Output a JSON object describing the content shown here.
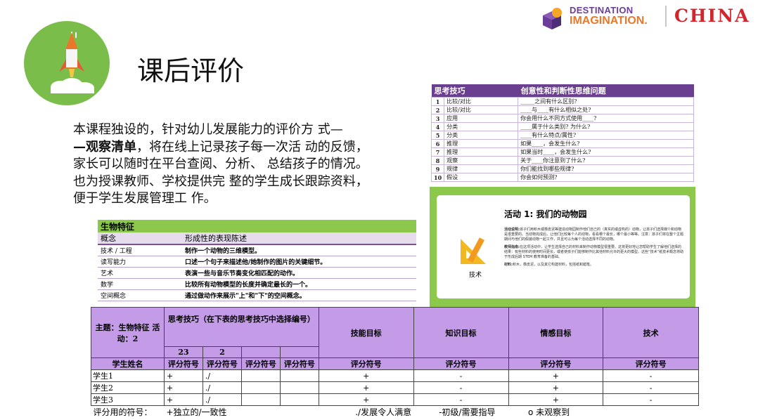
{
  "page": {
    "title": "课后评价",
    "paragraph_lines": [
      {
        "pre": "本课程独设的，针对幼儿发展能力的评价方 式—",
        "bold": "",
        "post": ""
      },
      {
        "pre": "",
        "bold": "—观察清单",
        "post": "，将在线上记录孩子每一次活 动的反馈，"
      },
      {
        "pre": "家长可以随时在平台查阅、分析、 总结孩子的情况。",
        "bold": "",
        "post": ""
      },
      {
        "pre": "也为授课教师、学校提供完 整的学生成长跟踪资料，",
        "bold": "",
        "post": ""
      },
      {
        "pre": "便于学生发展管理工 作。",
        "bold": "",
        "post": ""
      }
    ]
  },
  "brand": {
    "line1": "DESTINATION",
    "line2": "IMAGINATION.",
    "country": "CHINA",
    "colors": {
      "purple": "#6a3e98",
      "orange": "#e8792b",
      "red": "#d0262d"
    }
  },
  "thinking_table": {
    "headers": [
      "思考技巧",
      "创意性和判断性思维问题"
    ],
    "rows": [
      {
        "n": "1",
        "skill": "比较/对比",
        "q": "_____之间有什么区别?"
      },
      {
        "n": "2",
        "skill": "比较/对比",
        "q": "____与____有什么相似之处?"
      },
      {
        "n": "3",
        "skill": "应用",
        "q": "你会用什么不同方式使用____?"
      },
      {
        "n": "4",
        "skill": "分类",
        "q": "____属于什么类别? 为什么?"
      },
      {
        "n": "5",
        "skill": "分类",
        "q": "____有什么特点/属性?"
      },
      {
        "n": "6",
        "skill": "推理",
        "q": "如果____，会发生什么?"
      },
      {
        "n": "7",
        "skill": "推理",
        "q": "如果当时____，会发生什么?"
      },
      {
        "n": "8",
        "skill": "观察",
        "q": "关于____你注意到了什么?"
      },
      {
        "n": "9",
        "skill": "规律",
        "q": "你们能找到哪些规律?"
      },
      {
        "n": "10",
        "skill": "假设",
        "q": "你会如何预测?"
      }
    ]
  },
  "bio_table": {
    "title": "生物特征",
    "headers": [
      "概念",
      "形成性的表现陈述"
    ],
    "rows": [
      {
        "concept": "技术 / 工程",
        "stmt": "制作一个动物的三维模型。"
      },
      {
        "concept": "读写能力",
        "stmt": "口述一个句子来描述他/她制作的图片的关键细节。"
      },
      {
        "concept": "艺术",
        "stmt": "表演一些与音乐节奏变化相匹配的动作。"
      },
      {
        "concept": "数学",
        "stmt": "比较所有动物模型的长度并确定最长的一个。"
      },
      {
        "concept": "空间概念",
        "stmt": "通过做动作来展示\"上\"和\"下\"的空间概念。"
      }
    ]
  },
  "activity_card": {
    "title": "活动 1: 我们的动物园",
    "tag": "技术",
    "p1_label": "活动说明:",
    "p1": "孩子们用积木或橡皮泥等建造动物园制作他们自己的（真实的或虚构的）动物，让孩子们选择媒介和动物是很重要的。当动物完成后，让他们比较每个人的动物，看看哪个最长，哪个最小等等。注意：孩子们将在整个主题期间与他们的假装动物一起工作，并且可以为每个活动选择不同的动物。",
    "p2_label": "教师指南:",
    "p2": "在这项活动中，让学生选择自己的材料来制作动物模型很重要。这将更好地让您帮助学生了解他们选择的结果：有些材料的使用时间更长，或者使孩子们能够制作比其他材料允许的更大的模型。这些“技术”纸技术概念将助于形成后期 STEM 教育准备的基础。",
    "p3_label": "材料:",
    "p3": "积木，橡皮泥，以及其它构建材料，包括纸和蜡笔。"
  },
  "observation_sheet": {
    "theme_label": "主题：生物特征 活动：2",
    "skill_header": "思考技巧（在下表的思考技巧中选择编号）",
    "skill_nums": [
      "23",
      "2",
      "",
      ""
    ],
    "goal_headers": [
      "技能目标",
      "知识目标",
      "情感目标",
      "技术"
    ],
    "name_header": "学生姓名",
    "score_label": "评分符号",
    "students": [
      {
        "name": "学生1",
        "s1": "+",
        "s2": "./",
        "s3": "",
        "s4": "",
        "g1": "+",
        "g2": "-",
        "g3": "+",
        "g4": "-"
      },
      {
        "name": "学生2",
        "s1": "+",
        "s2": "./",
        "s3": "",
        "s4": "",
        "g1": "+",
        "g2": "-",
        "g3": "+",
        "g4": "-"
      },
      {
        "name": "学生3",
        "s1": "+",
        "s2": "./",
        "s3": "",
        "s4": "",
        "g1": "+",
        "g2": "-",
        "g3": "+",
        "g4": "-"
      }
    ],
    "legend": {
      "label": "评分用的符号：",
      "a": "+独立的/一致性",
      "b": "./发展令人满意",
      "c": "-初级/需要指导",
      "d": "o 未观察到"
    }
  },
  "icons": [
    "rocket-icon",
    "ruler-triangle-icon",
    "cube-icon"
  ]
}
